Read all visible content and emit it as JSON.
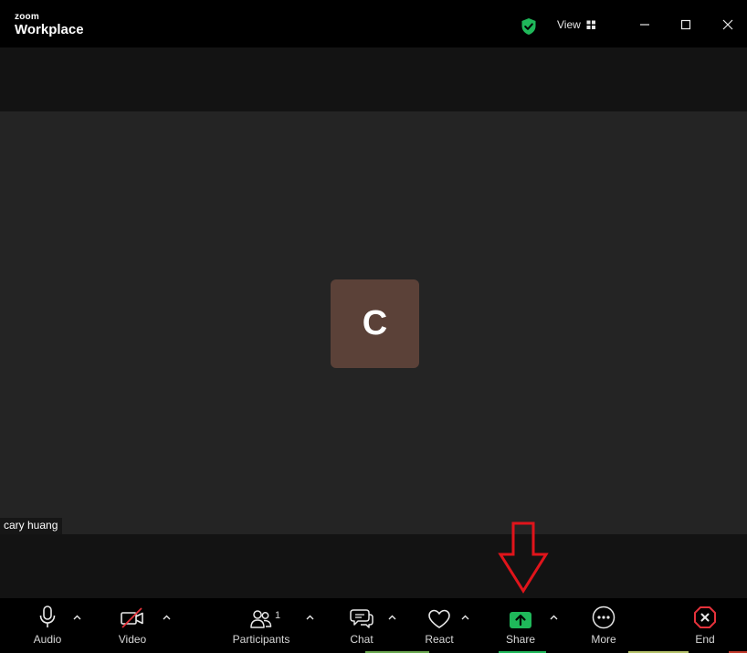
{
  "app": {
    "brand_top": "zoom",
    "brand_bottom": "Workplace"
  },
  "titlebar": {
    "view_label": "View",
    "security_icon": "green-shield-check-icon",
    "minimize_icon": "minimize-icon",
    "maximize_icon": "maximize-icon",
    "close_icon": "close-icon"
  },
  "participant": {
    "initial": "C",
    "name": "cary huang",
    "avatar_color": "#5b4138"
  },
  "toolbar": {
    "audio_label": "Audio",
    "video_label": "Video",
    "participants_label": "Participants",
    "participants_count": "1",
    "chat_label": "Chat",
    "react_label": "React",
    "share_label": "Share",
    "more_label": "More",
    "end_label": "End"
  },
  "colors": {
    "accent_green": "#1fb85a",
    "end_red": "#e5323b",
    "annotation_red": "#e0141b",
    "tile_background": "#242424"
  },
  "annotation": {
    "type": "red-down-arrow",
    "points_to": "share-button"
  }
}
